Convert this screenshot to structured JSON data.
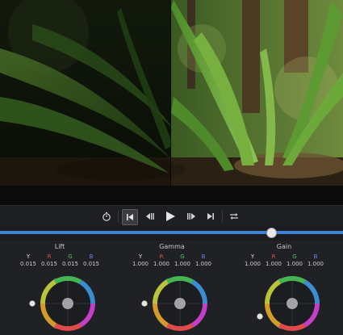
{
  "transport": {
    "buttons": [
      {
        "name": "timer-icon",
        "glyph": "⏱"
      },
      {
        "name": "go-to-start-icon",
        "glyph": "⏮"
      },
      {
        "name": "step-back-icon",
        "glyph": "◀"
      },
      {
        "name": "play-icon",
        "glyph": "▶"
      },
      {
        "name": "step-forward-icon",
        "glyph": "▶"
      },
      {
        "name": "go-to-end-icon",
        "glyph": "⏭"
      },
      {
        "name": "loop-icon",
        "glyph": "↻"
      }
    ],
    "active_button": "go-to-start-icon"
  },
  "scrubber": {
    "progress": 0.79,
    "track_color": "#3f7fd1"
  },
  "color_wheels": [
    {
      "title": "Lift",
      "channels": [
        "Y",
        "R",
        "G",
        "B"
      ],
      "values": [
        "0.015",
        "0.015",
        "0.015",
        "0.015"
      ]
    },
    {
      "title": "Gamma",
      "channels": [
        "Y",
        "R",
        "G",
        "B"
      ],
      "values": [
        "1.000",
        "1.000",
        "1.000",
        "1.000"
      ]
    },
    {
      "title": "Gain",
      "channels": [
        "Y",
        "R",
        "G",
        "B"
      ],
      "values": [
        "1.000",
        "1.000",
        "1.000",
        "1.000"
      ]
    }
  ],
  "channel_colors": {
    "Y": "#e3e3e6",
    "R": "#e0504c",
    "G": "#58c25a",
    "B": "#6e86f0"
  }
}
